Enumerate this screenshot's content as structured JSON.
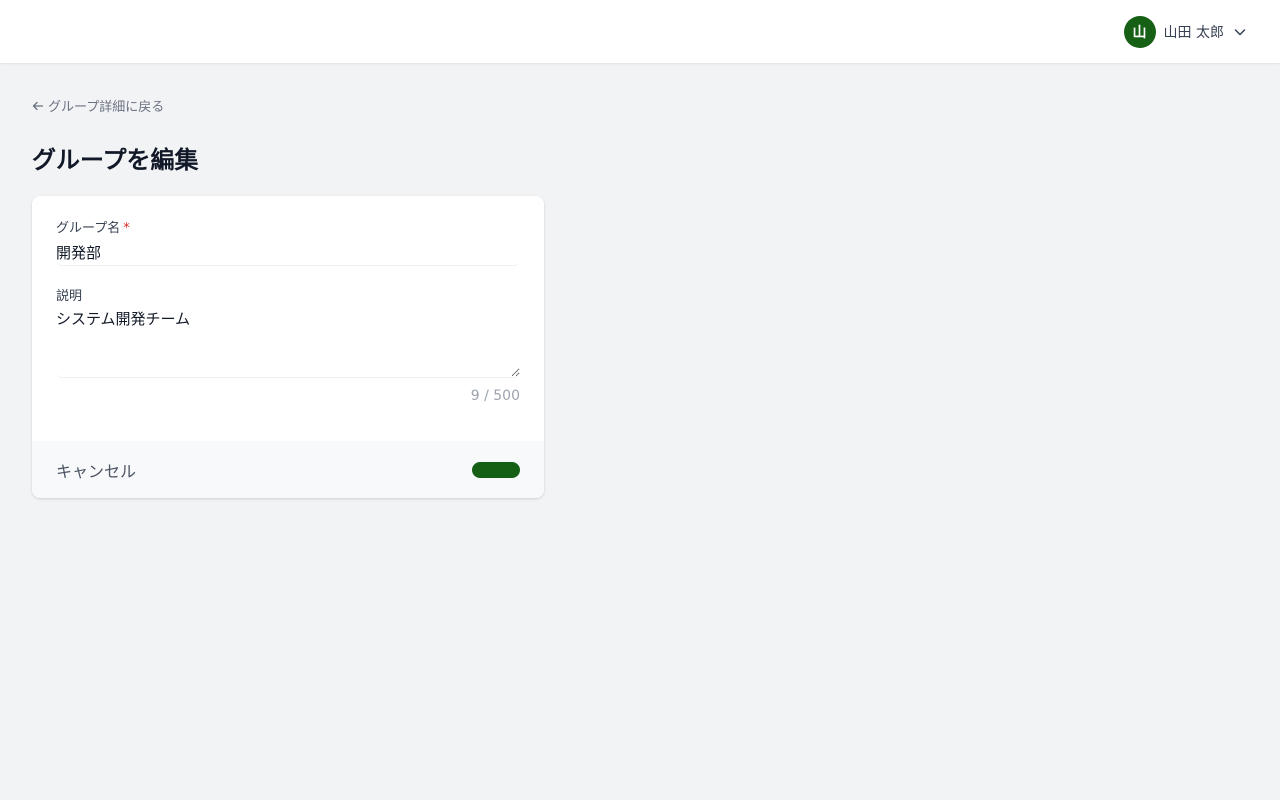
{
  "header": {
    "user": {
      "avatar_initial": "山",
      "name": "山田 太郎"
    }
  },
  "nav": {
    "back_label": "グループ詳細に戻る"
  },
  "page": {
    "title": "グループを編集"
  },
  "form": {
    "name_label": "グループ名",
    "required_mark": "*",
    "name_value": "開発部",
    "description_label": "説明",
    "description_value": "システム開発チーム",
    "char_counter": "9 / 500",
    "cancel_label": "キャンセル",
    "save_label": ""
  },
  "colors": {
    "brand": "#166016",
    "page_background": "#f2f3f5",
    "required": "#dc2626"
  },
  "icons": [
    "arrow-left-icon",
    "chevron-down-icon"
  ]
}
